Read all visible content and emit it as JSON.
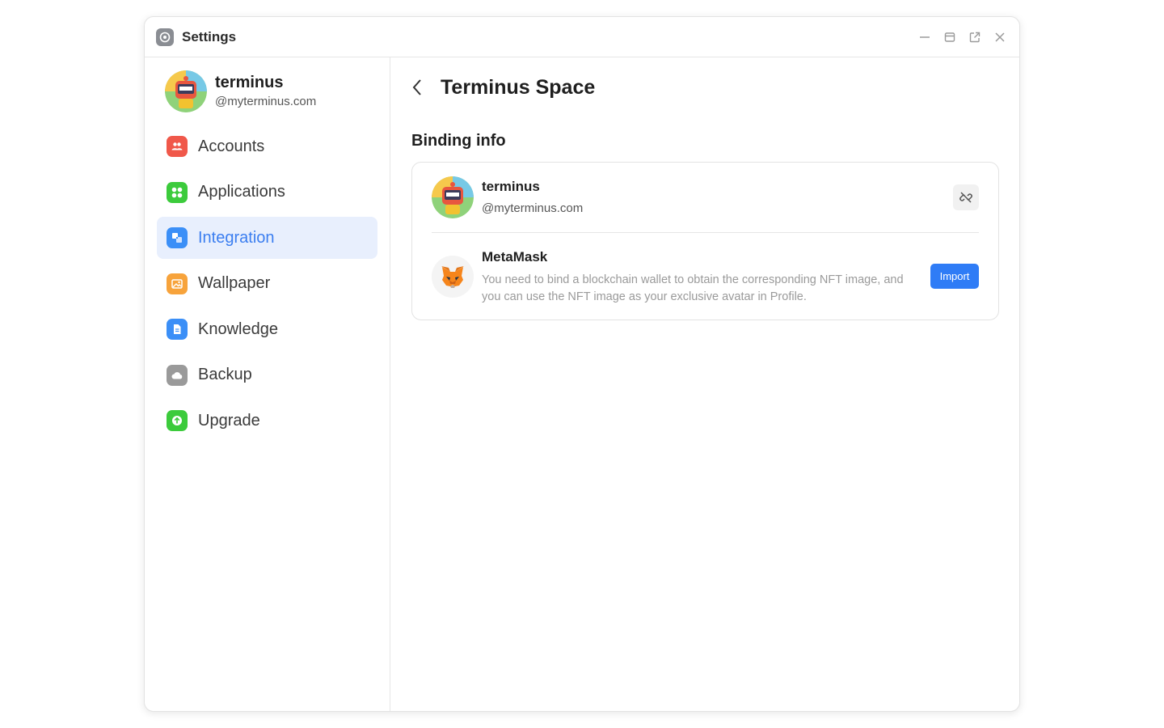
{
  "window": {
    "title": "Settings",
    "controls": [
      "minimize-icon",
      "restore-icon",
      "popout-icon",
      "close-icon"
    ]
  },
  "profile": {
    "name": "terminus",
    "handle": "@myterminus.com"
  },
  "sidebar": {
    "items": [
      {
        "label": "Accounts",
        "icon": "accounts-icon",
        "color": "#f0584a",
        "active": false
      },
      {
        "label": "Applications",
        "icon": "applications-icon",
        "color": "#3ccb3c",
        "active": false
      },
      {
        "label": "Integration",
        "icon": "integration-icon",
        "color": "#3b8ff7",
        "active": true
      },
      {
        "label": "Wallpaper",
        "icon": "wallpaper-icon",
        "color": "#f7a33b",
        "active": false
      },
      {
        "label": "Knowledge",
        "icon": "knowledge-icon",
        "color": "#3b8ff7",
        "active": false
      },
      {
        "label": "Backup",
        "icon": "backup-icon",
        "color": "#9a9a9a",
        "active": false
      },
      {
        "label": "Upgrade",
        "icon": "upgrade-icon",
        "color": "#3ccb3c",
        "active": false
      }
    ]
  },
  "main": {
    "title": "Terminus Space",
    "section_title": "Binding info",
    "binding": {
      "name": "terminus",
      "handle": "@myterminus.com"
    },
    "metamask": {
      "title": "MetaMask",
      "description": "You need to bind a blockchain wallet to obtain the corresponding NFT image, and you can use the NFT image as your exclusive avatar in Profile.",
      "button_label": "Import"
    }
  },
  "colors": {
    "accent": "#2f7cf6",
    "active_bg": "#e8effd"
  }
}
